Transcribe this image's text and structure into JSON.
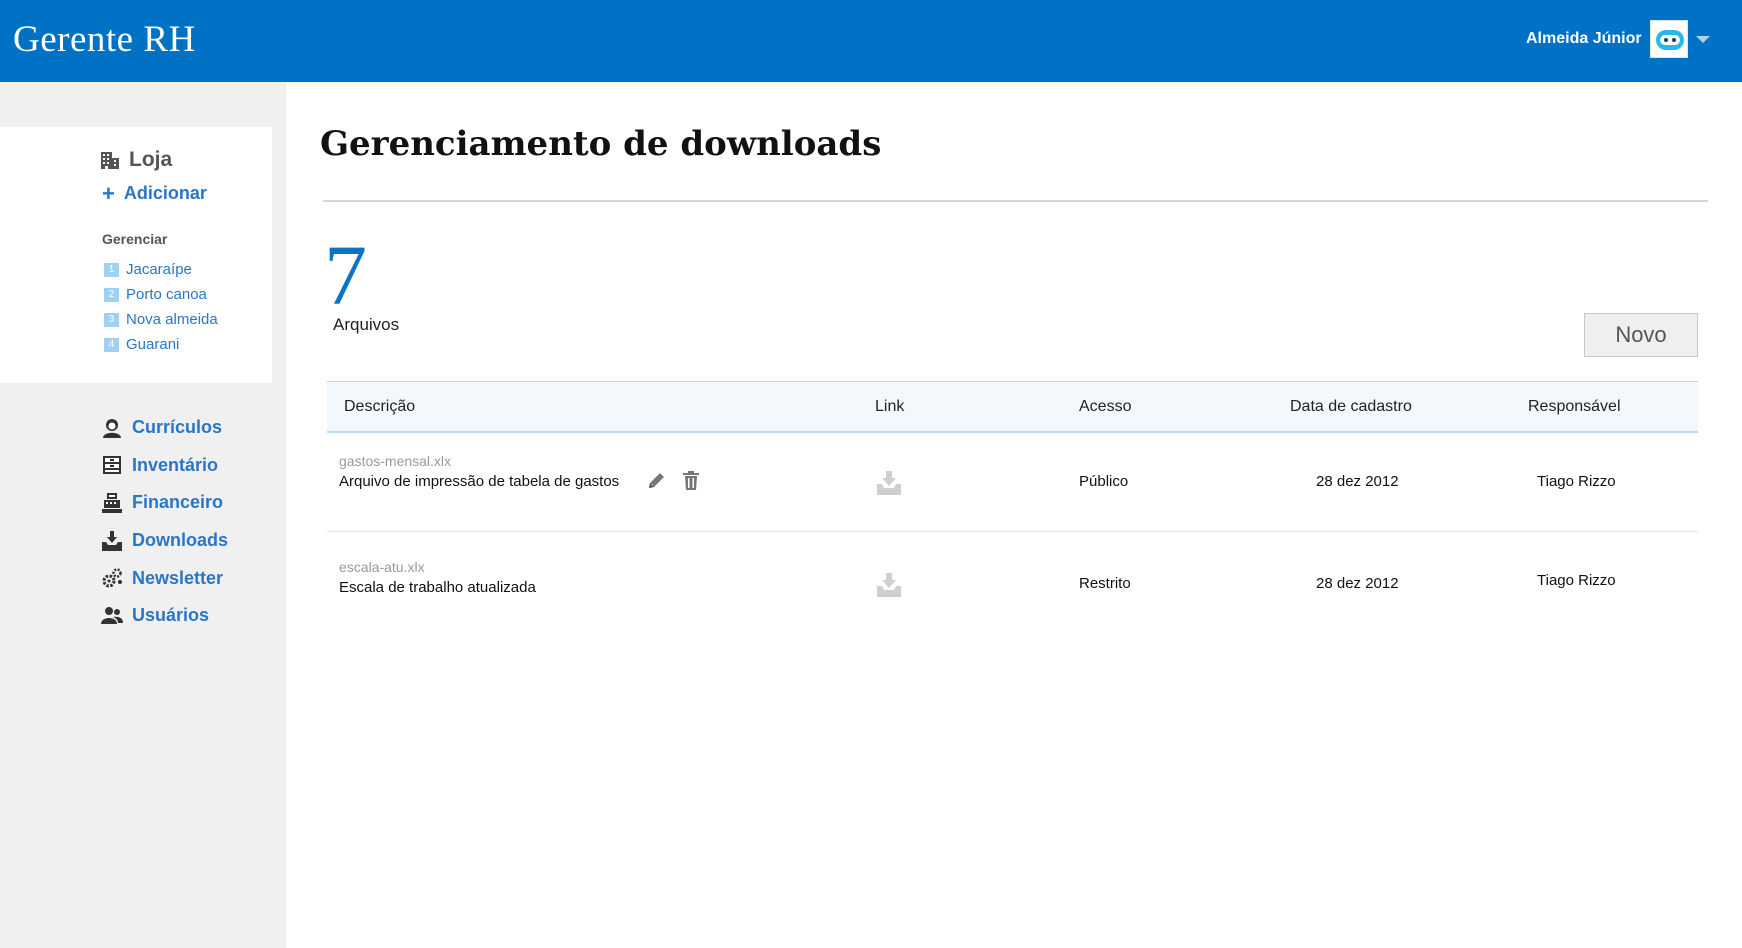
{
  "header": {
    "app_title": "Gerente RH",
    "user_name": "Almeida Júnior",
    "brand_color": "#0072c6"
  },
  "sidebar": {
    "store": {
      "label": "Loja",
      "icon": "building-icon"
    },
    "add_label": "Adicionar",
    "manage_heading": "Gerenciar",
    "branches": [
      {
        "num": "1",
        "name": "Jacaraípe"
      },
      {
        "num": "2",
        "name": "Porto canoa"
      },
      {
        "num": "3",
        "name": "Nova almeida"
      },
      {
        "num": "4",
        "name": "Guarani"
      }
    ],
    "nav": [
      {
        "label": "Currículos",
        "icon": "user-profile-icon"
      },
      {
        "label": "Inventário",
        "icon": "inventory-icon"
      },
      {
        "label": "Financeiro",
        "icon": "cash-register-icon"
      },
      {
        "label": "Downloads",
        "icon": "download-tray-icon"
      },
      {
        "label": "Newsletter",
        "icon": "gears-icon"
      },
      {
        "label": "Usuários",
        "icon": "users-icon"
      }
    ]
  },
  "main": {
    "title": "Gerenciamento de downloads",
    "file_count": "7",
    "file_count_label": "Arquivos",
    "new_button": "Novo",
    "table": {
      "headers": [
        "Descrição",
        "Link",
        "Acesso",
        "Data de cadastro",
        "Responsável"
      ],
      "rows": [
        {
          "file": "gastos-mensal.xlx",
          "description": "Arquivo de impressão de tabela de gastos",
          "access": "Público",
          "date": "28 dez 2012",
          "owner": "Tiago Rizzo"
        },
        {
          "file": "escala-atu.xlx",
          "description": "Escala de trabalho atualizada",
          "access": "Restrito",
          "date": "28 dez 2012",
          "owner": "Tiago Rizzo"
        }
      ]
    }
  }
}
